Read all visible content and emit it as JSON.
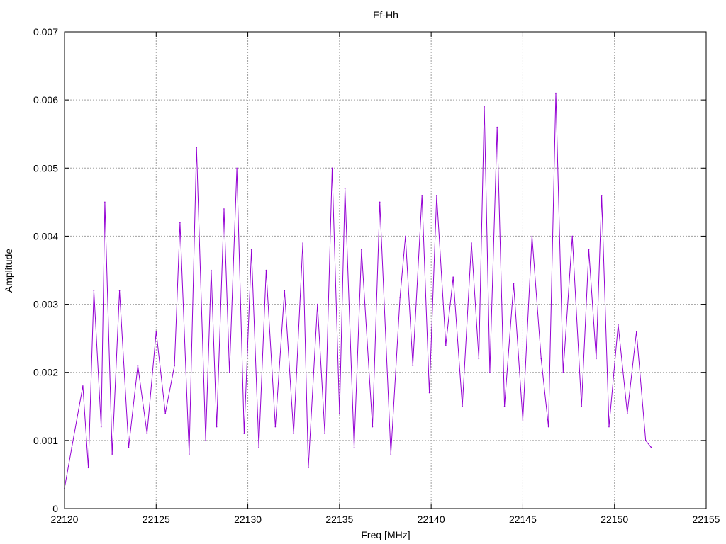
{
  "chart_data": {
    "type": "line",
    "title": "Ef-Hh",
    "xlabel": "Freq [MHz]",
    "ylabel": "Amplitude",
    "xlim": [
      22120,
      22155
    ],
    "ylim": [
      0,
      0.007
    ],
    "xticks": [
      22120,
      22125,
      22130,
      22135,
      22140,
      22145,
      22150,
      22155
    ],
    "yticks": [
      0,
      0.001,
      0.002,
      0.003,
      0.004,
      0.005,
      0.006,
      0.007
    ],
    "xtick_labels": [
      "22120",
      "22125",
      "22130",
      "22135",
      "22140",
      "22145",
      "22150",
      "22155"
    ],
    "ytick_labels": [
      "0",
      "0.001",
      "0.002",
      "0.003",
      "0.004",
      "0.005",
      "0.006",
      "0.007"
    ],
    "grid": true,
    "legend": false,
    "line_color": "#9400d3",
    "series": [
      {
        "x": [
          22120,
          22120.4,
          22121,
          22121.3,
          22121.6,
          22122,
          22122.2,
          22122.6,
          22123,
          22123.5,
          22124,
          22124.5,
          22125,
          22125.5,
          22126,
          22126.3,
          22126.8,
          22127.2,
          22127.7,
          22128,
          22128.3,
          22128.7,
          22129,
          22129.4,
          22129.8,
          22130.2,
          22130.6,
          22131,
          22131.5,
          22132,
          22132.5,
          22133,
          22133.3,
          22133.8,
          22134.2,
          22134.6,
          22135,
          22135.3,
          22135.8,
          22136.2,
          22136.8,
          22137.2,
          22137.8,
          22138.3,
          22138.6,
          22139,
          22139.5,
          22139.9,
          22140.3,
          22140.8,
          22141.2,
          22141.7,
          22142.2,
          22142.6,
          22142.9,
          22143.2,
          22143.6,
          22144,
          22144.5,
          22145,
          22145.5,
          22146,
          22146.4,
          22146.8,
          22147.2,
          22147.7,
          22148.2,
          22148.6,
          22149,
          22149.3,
          22149.7,
          22150.2,
          22150.7,
          22151.2,
          22151.7,
          22152
        ],
        "y": [
          0.0003,
          0.0009,
          0.0018,
          0.0006,
          0.0032,
          0.0012,
          0.0045,
          0.0008,
          0.0032,
          0.0009,
          0.0021,
          0.0011,
          0.0026,
          0.0014,
          0.0021,
          0.0042,
          0.0008,
          0.0053,
          0.001,
          0.0035,
          0.0012,
          0.0044,
          0.002,
          0.005,
          0.0011,
          0.0038,
          0.0009,
          0.0035,
          0.0012,
          0.0032,
          0.0011,
          0.0039,
          0.0006,
          0.003,
          0.0011,
          0.005,
          0.0014,
          0.0047,
          0.0009,
          0.0038,
          0.0012,
          0.0045,
          0.0008,
          0.0031,
          0.004,
          0.0021,
          0.0046,
          0.0017,
          0.0046,
          0.0024,
          0.0034,
          0.0015,
          0.0039,
          0.0022,
          0.0059,
          0.002,
          0.0056,
          0.0015,
          0.0033,
          0.0013,
          0.004,
          0.0022,
          0.0012,
          0.0061,
          0.002,
          0.004,
          0.0015,
          0.0038,
          0.0022,
          0.0046,
          0.0012,
          0.0027,
          0.0014,
          0.0026,
          0.001,
          0.0009
        ]
      }
    ]
  }
}
